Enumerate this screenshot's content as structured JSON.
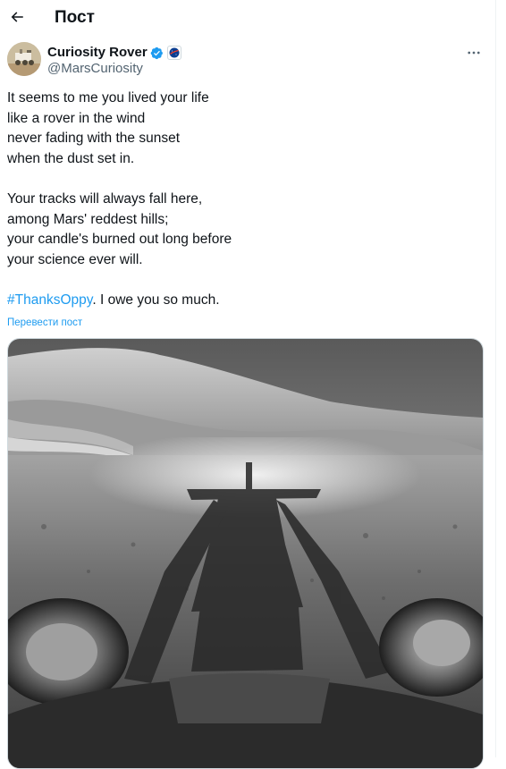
{
  "header": {
    "title": "Пост"
  },
  "author": {
    "name": "Curiosity Rover",
    "handle": "@MarsCuriosity",
    "badge_label": "NASA"
  },
  "tweet": {
    "stanza1": [
      "It seems to me you lived your life",
      "like a rover in the wind",
      "never fading with the sunset",
      "when the dust set in."
    ],
    "stanza2": [
      "Your tracks will always fall here,",
      "among Mars' reddest hills;",
      "your candle's burned out long before",
      "your science ever will."
    ],
    "hashtag": "#ThanksOppy",
    "closing": ". I owe you so much.",
    "translate": "Перевести пост"
  },
  "colors": {
    "accent": "#1d9bf0",
    "text": "#0f1419",
    "secondary": "#536471"
  },
  "icons": {
    "back": "arrow-left-icon",
    "verified": "verified-badge-icon",
    "more": "more-horizontal-icon"
  }
}
